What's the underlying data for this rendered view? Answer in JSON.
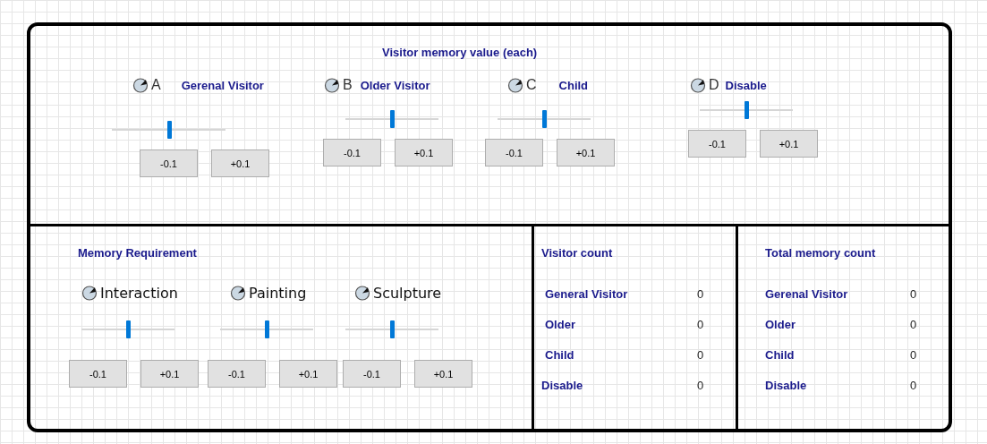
{
  "visitor_memory": {
    "title": "Visitor memory value (each)",
    "groups": [
      {
        "letter": "A",
        "label": "Gerenal Visitor",
        "level": 0.5,
        "buttons": [
          "-0.1",
          "+0.1"
        ]
      },
      {
        "letter": "B",
        "label": "Older Visitor",
        "level": 0.5,
        "buttons": [
          "-0.1",
          "+0.1"
        ]
      },
      {
        "letter": "C",
        "label": "Child",
        "level": 0.5,
        "buttons": [
          "-0.1",
          "+0.1"
        ]
      },
      {
        "letter": "D",
        "label": "Disable",
        "level": 0.5,
        "buttons": [
          "-0.1",
          "+0.1"
        ]
      }
    ]
  },
  "memory_requirement": {
    "title": "Memory Requirement",
    "items": [
      {
        "label": "Interaction",
        "level": 0.5,
        "buttons": [
          "-0.1",
          "+0.1"
        ]
      },
      {
        "label": "Painting",
        "level": 0.5,
        "buttons": [
          "-0.1",
          "+0.1"
        ]
      },
      {
        "label": "Sculpture",
        "level": 0.5,
        "buttons": [
          "-0.1",
          "+0.1"
        ]
      }
    ]
  },
  "visitor_count": {
    "title": "Visitor count",
    "rows": [
      {
        "label": "General Visitor",
        "value": "0"
      },
      {
        "label": "Older",
        "value": "0"
      },
      {
        "label": "Child",
        "value": "0"
      },
      {
        "label": "Disable",
        "value": "0"
      }
    ]
  },
  "total_memory_count": {
    "title": "Total memory count",
    "rows": [
      {
        "label": "Gerenal Visitor",
        "value": "0"
      },
      {
        "label": "Older",
        "value": "0"
      },
      {
        "label": "Child",
        "value": "0"
      },
      {
        "label": "Disable",
        "value": "0"
      }
    ]
  }
}
